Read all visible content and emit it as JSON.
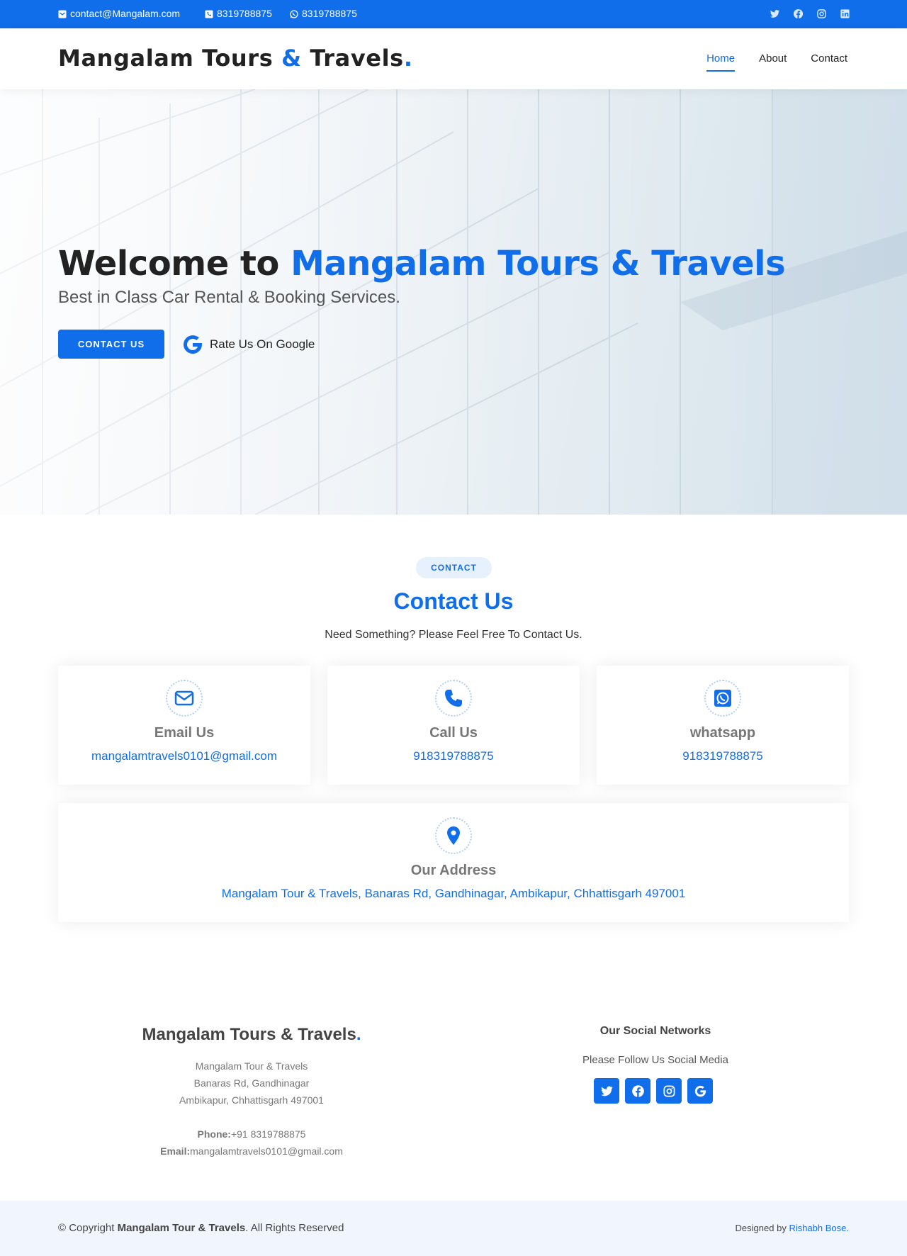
{
  "topbar": {
    "email": "contact@Mangalam.com",
    "phone": "8319788875",
    "whatsapp": "8319788875",
    "socials": [
      "twitter-icon",
      "facebook-icon",
      "instagram-icon",
      "linkedin-icon"
    ]
  },
  "header": {
    "logo_part1": "Mangalam Tours ",
    "logo_amp": "&",
    "logo_part2": " Travels",
    "logo_dot": ".",
    "nav": [
      {
        "label": "Home",
        "active": true
      },
      {
        "label": "About",
        "active": false
      },
      {
        "label": "Contact",
        "active": false
      }
    ]
  },
  "hero": {
    "title_prefix": "Welcome to ",
    "title_brand": "Mangalam Tours & Travels",
    "subtitle": "Best in Class Car Rental & Booking Services.",
    "cta_label": "CONTACT US",
    "google_label": "Rate Us On Google"
  },
  "contact": {
    "badge": "CONTACT",
    "title": "Contact Us",
    "subtitle": "Need Something? Please Feel Free To Contact Us.",
    "cards": [
      {
        "icon": "envelope-icon",
        "title": "Email Us",
        "value": "mangalamtravels0101@gmail.com"
      },
      {
        "icon": "phone-icon",
        "title": "Call Us",
        "value": "918319788875"
      },
      {
        "icon": "whatsapp-icon",
        "title": "whatsapp",
        "value": "918319788875"
      }
    ],
    "address": {
      "icon": "map-pin-icon",
      "title": "Our Address",
      "value": "Mangalam Tour & Travels, Banaras Rd, Gandhinagar, Ambikapur, Chhattisgarh 497001"
    }
  },
  "footer": {
    "brand": "Mangalam Tours & Travels",
    "brand_dot": ".",
    "address_lines": [
      "Mangalam Tour & Travels",
      "Banaras Rd, Gandhinagar",
      "Ambikapur, Chhattisgarh 497001"
    ],
    "phone_label": "Phone:",
    "phone_value": "+91 8319788875",
    "email_label": "Email:",
    "email_value": "mangalamtravels0101@gmail.com",
    "social_title": "Our Social Networks",
    "social_sub": "Please Follow Us Social Media",
    "social_icons": [
      "twitter-icon",
      "facebook-icon",
      "instagram-icon",
      "google-icon"
    ],
    "copyright_prefix": "© Copyright ",
    "copyright_brand": "Mangalam Tour & Travels",
    "copyright_suffix": ". All Rights Reserved",
    "designed_prefix": "Designed by ",
    "designed_by": "Rishabh Bose."
  },
  "colors": {
    "accent": "#106eea",
    "text_dark": "#222222",
    "muted": "#777777",
    "footer_bg": "#f1f6fe"
  }
}
